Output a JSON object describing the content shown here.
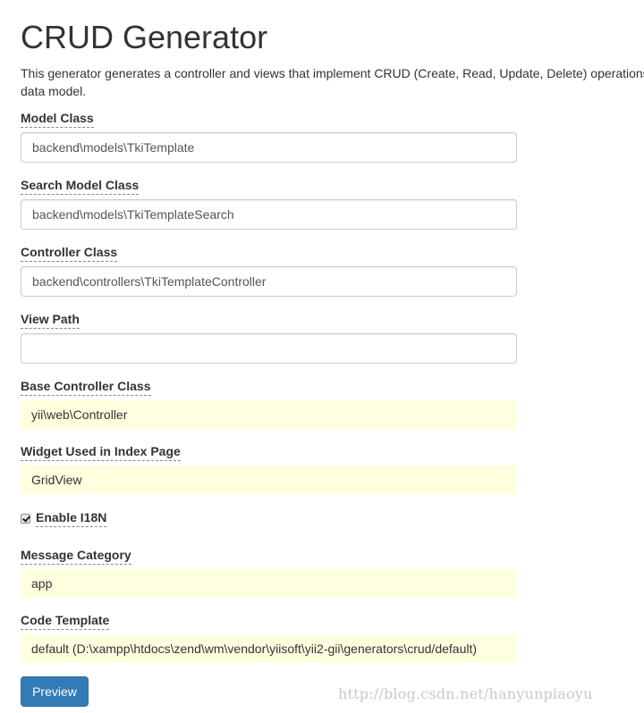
{
  "page": {
    "title": "CRUD Generator",
    "description_line1": "This generator generates a controller and views that implement CRUD (Create, Read, Update, Delete) operations for the specified",
    "description_line2": "data model."
  },
  "fields": {
    "model_class": {
      "label": "Model Class",
      "value": "backend\\models\\TkiTemplate"
    },
    "search_model_class": {
      "label": "Search Model Class",
      "value": "backend\\models\\TkiTemplateSearch"
    },
    "controller_class": {
      "label": "Controller Class",
      "value": "backend\\controllers\\TkiTemplateController"
    },
    "view_path": {
      "label": "View Path",
      "value": ""
    },
    "base_controller_class": {
      "label": "Base Controller Class",
      "value": "yii\\web\\Controller"
    },
    "index_widget": {
      "label": "Widget Used in Index Page",
      "value": "GridView"
    },
    "enable_i18n": {
      "label": "Enable I18N",
      "checked": true
    },
    "message_category": {
      "label": "Message Category",
      "value": "app"
    },
    "code_template": {
      "label": "Code Template",
      "value": "default (D:\\xampp\\htdocs\\zend\\wm\\vendor\\yiisoft\\yii2-gii\\generators\\crud/default)"
    }
  },
  "actions": {
    "preview_label": "Preview"
  },
  "watermark": {
    "text": "http://blog.csdn.net/hanyunpiaoyu"
  },
  "colors": {
    "primary_button": "#337ab7",
    "sticky_background": "#ffffe0",
    "input_border": "#cccccc"
  }
}
